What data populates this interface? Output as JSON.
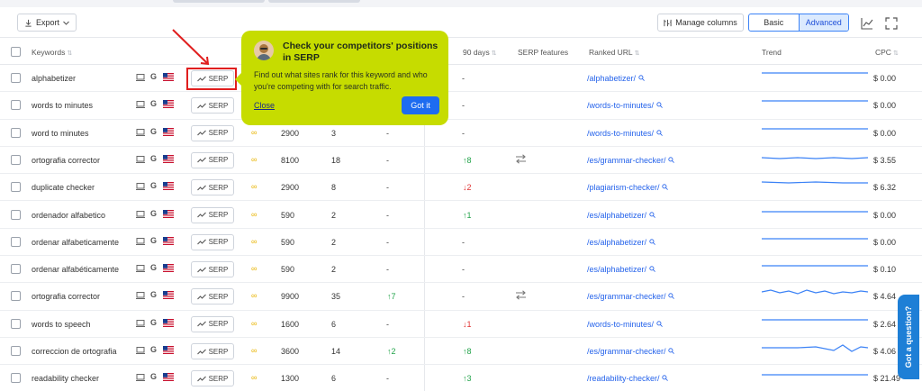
{
  "toolbar": {
    "export_label": "Export",
    "manage_columns_label": "Manage columns",
    "view_basic": "Basic",
    "view_advanced": "Advanced"
  },
  "headers": {
    "keywords": "Keywords",
    "days90": "90 days",
    "serp_features": "SERP features",
    "ranked_url": "Ranked URL",
    "trend": "Trend",
    "cpc": "CPC"
  },
  "serp_label": "SERP",
  "rows": [
    {
      "keyword": "alphabetizer",
      "volume": "",
      "kd": "",
      "pos_change": "",
      "change90": "-",
      "change90_dir": "none",
      "serp_feature": false,
      "url": "/alphabetizer/",
      "cpc": "$ 0.00"
    },
    {
      "keyword": "words to minutes",
      "volume": "",
      "kd": "",
      "pos_change": "",
      "change90": "-",
      "change90_dir": "none",
      "serp_feature": false,
      "url": "/words-to-minutes/",
      "cpc": "$ 0.00"
    },
    {
      "keyword": "word to minutes",
      "volume": "2900",
      "kd": "3",
      "pos_change": "-",
      "change90": "-",
      "change90_dir": "none",
      "serp_feature": false,
      "url": "/words-to-minutes/",
      "cpc": "$ 0.00"
    },
    {
      "keyword": "ortografia corrector",
      "volume": "8100",
      "kd": "18",
      "pos_change": "-",
      "change90": "8",
      "change90_dir": "up",
      "serp_feature": true,
      "url": "/es/grammar-checker/",
      "cpc": "$ 3.55"
    },
    {
      "keyword": "duplicate checker",
      "volume": "2900",
      "kd": "8",
      "pos_change": "-",
      "change90": "2",
      "change90_dir": "down",
      "serp_feature": false,
      "url": "/plagiarism-checker/",
      "cpc": "$ 6.32"
    },
    {
      "keyword": "ordenador alfabetico",
      "volume": "590",
      "kd": "2",
      "pos_change": "-",
      "change90": "1",
      "change90_dir": "up",
      "serp_feature": false,
      "url": "/es/alphabetizer/",
      "cpc": "$ 0.00"
    },
    {
      "keyword": "ordenar alfabeticamente",
      "volume": "590",
      "kd": "2",
      "pos_change": "-",
      "change90": "-",
      "change90_dir": "none",
      "serp_feature": false,
      "url": "/es/alphabetizer/",
      "cpc": "$ 0.00"
    },
    {
      "keyword": "ordenar alfabéticamente",
      "volume": "590",
      "kd": "2",
      "pos_change": "-",
      "change90": "-",
      "change90_dir": "none",
      "serp_feature": false,
      "url": "/es/alphabetizer/",
      "cpc": "$ 0.10"
    },
    {
      "keyword": "ortografia corrector",
      "volume": "9900",
      "kd": "35",
      "pos_change": "7",
      "pos_dir": "up",
      "change90": "-",
      "change90_dir": "none",
      "serp_feature": true,
      "url": "/es/grammar-checker/",
      "cpc": "$ 4.64"
    },
    {
      "keyword": "words to speech",
      "volume": "1600",
      "kd": "6",
      "pos_change": "-",
      "change90": "1",
      "change90_dir": "down",
      "serp_feature": false,
      "url": "/words-to-minutes/",
      "cpc": "$ 2.64"
    },
    {
      "keyword": "correccion de ortografia",
      "volume": "3600",
      "kd": "14",
      "pos_change": "2",
      "pos_dir": "up",
      "change90": "8",
      "change90_dir": "up",
      "serp_feature": false,
      "url": "/es/grammar-checker/",
      "cpc": "$ 4.06"
    },
    {
      "keyword": "readability checker",
      "volume": "1300",
      "kd": "6",
      "pos_change": "-",
      "change90": "3",
      "change90_dir": "up",
      "serp_feature": false,
      "url": "/readability-checker/",
      "cpc": "$ 21.49"
    }
  ],
  "tooltip": {
    "title": "Check your competitors' positions in SERP",
    "body": "Find out what sites rank for this keyword and who you're competing with for search traffic.",
    "close_label": "Close",
    "got_it_label": "Got it"
  },
  "help_tab": "Got a question?",
  "colors": {
    "tooltip_bg": "#c6dc00",
    "accent": "#1d6cf0",
    "up": "#22a34a",
    "down": "#e03131",
    "link": "#2563eb"
  }
}
